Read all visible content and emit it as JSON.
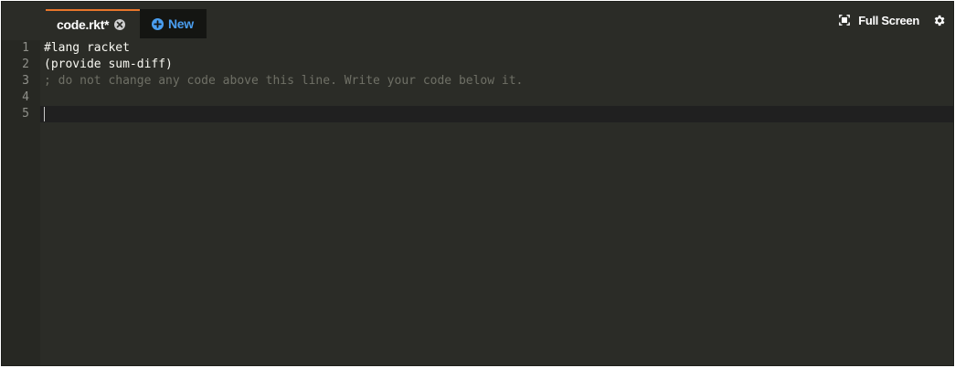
{
  "tabs": {
    "active_label": "code.rkt*",
    "new_label": "New"
  },
  "toolbar": {
    "fullscreen_label": "Full Screen"
  },
  "editor": {
    "line_numbers": [
      "1",
      "2",
      "3",
      "4",
      "5"
    ],
    "lines": [
      "#lang racket",
      "(provide sum-diff)",
      "; do not change any code above this line. Write your code below it.",
      "",
      ""
    ],
    "active_line": 5
  },
  "colors": {
    "background": "#2b2c27",
    "tab_accent": "#e8762b",
    "new_tab_text": "#4a9ef0",
    "comment": "#6f7066"
  }
}
